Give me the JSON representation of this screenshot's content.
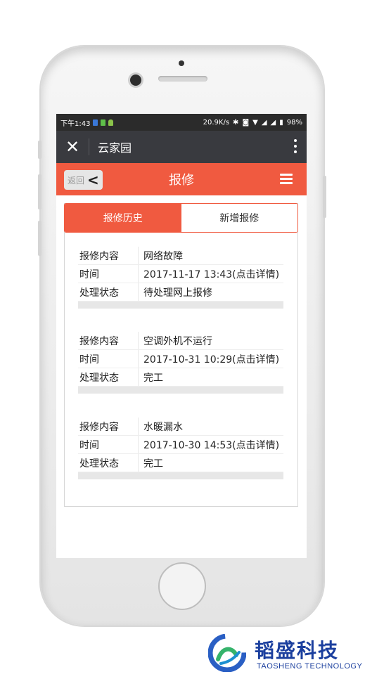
{
  "status_bar": {
    "time": "下午1:43",
    "network_speed": "20.9K/s",
    "battery": "98%"
  },
  "wechat_nav": {
    "close_icon": "close-icon",
    "title": "云家园",
    "more_icon": "more-vertical-icon"
  },
  "header": {
    "back_label": "返回",
    "title": "报修",
    "menu_icon": "hamburger-menu-icon",
    "color": "#f05a40"
  },
  "tabs": [
    {
      "label": "报修历史",
      "active": true
    },
    {
      "label": "新增报修",
      "active": false
    }
  ],
  "records": [
    {
      "content_label": "报修内容",
      "content": "网络故障",
      "time_label": "时间",
      "time": "2017-11-17 13:43(点击详情)",
      "status_label": "处理状态",
      "status": "待处理网上报修"
    },
    {
      "content_label": "报修内容",
      "content": "空调外机不运行",
      "time_label": "时间",
      "time": "2017-10-31 10:29(点击详情)",
      "status_label": "处理状态",
      "status": "完工"
    },
    {
      "content_label": "报修内容",
      "content": "水暖漏水",
      "time_label": "时间",
      "time": "2017-10-30 14:53(点击详情)",
      "status_label": "处理状态",
      "status": "完工"
    }
  ],
  "watermark": {
    "name_cn": "韬盛科技",
    "name_en": "TAOSHENG TECHNOLOGY",
    "brand_color": "#1b3f9e"
  }
}
